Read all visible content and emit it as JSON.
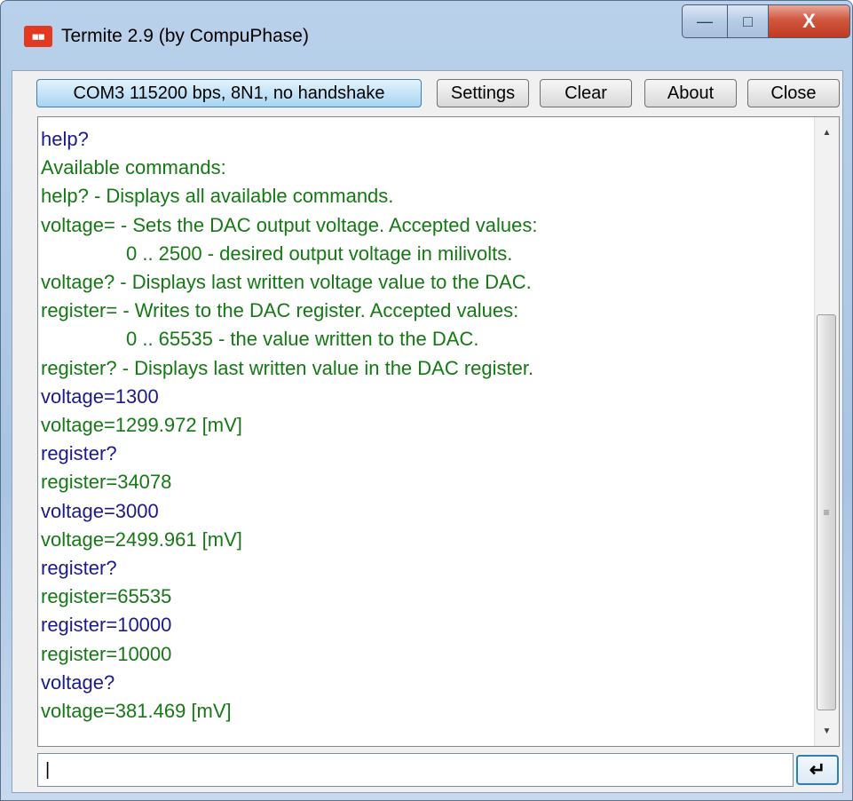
{
  "window": {
    "title": "Termite 2.9 (by CompuPhase)",
    "app_icon": "termite-icon",
    "controls": {
      "minimize": "—",
      "maximize": "□",
      "close": "X"
    }
  },
  "toolbar": {
    "port_label": "COM3 115200 bps, 8N1, no handshake",
    "settings_label": "Settings",
    "clear_label": "Clear",
    "about_label": "About",
    "close_label": "Close"
  },
  "terminal": {
    "lines": [
      {
        "text": "help?",
        "kind": "tx",
        "indent": false
      },
      {
        "text": "Available commands:",
        "kind": "rx",
        "indent": false
      },
      {
        "text": "help? - Displays all available commands.",
        "kind": "rx",
        "indent": false
      },
      {
        "text": "voltage= - Sets the DAC output voltage. Accepted values:",
        "kind": "rx",
        "indent": false
      },
      {
        "text": "0 .. 2500 - desired output voltage in milivolts.",
        "kind": "rx",
        "indent": true
      },
      {
        "text": "voltage? - Displays last written voltage value to the DAC.",
        "kind": "rx",
        "indent": false
      },
      {
        "text": "register= - Writes to the DAC register. Accepted values:",
        "kind": "rx",
        "indent": false
      },
      {
        "text": "0 .. 65535 - the value written to the DAC.",
        "kind": "rx",
        "indent": true
      },
      {
        "text": "register? - Displays last written value in the DAC register.",
        "kind": "rx",
        "indent": false
      },
      {
        "text": "voltage=1300",
        "kind": "tx",
        "indent": false
      },
      {
        "text": "voltage=1299.972 [mV]",
        "kind": "rx",
        "indent": false
      },
      {
        "text": "register?",
        "kind": "tx",
        "indent": false
      },
      {
        "text": "register=34078",
        "kind": "rx",
        "indent": false
      },
      {
        "text": "voltage=3000",
        "kind": "tx",
        "indent": false
      },
      {
        "text": "voltage=2499.961 [mV]",
        "kind": "rx",
        "indent": false
      },
      {
        "text": "register?",
        "kind": "tx",
        "indent": false
      },
      {
        "text": "register=65535",
        "kind": "rx",
        "indent": false
      },
      {
        "text": "register=10000",
        "kind": "tx",
        "indent": false
      },
      {
        "text": "register=10000",
        "kind": "rx",
        "indent": false
      },
      {
        "text": "voltage?",
        "kind": "tx",
        "indent": false
      },
      {
        "text": "voltage=381.469 [mV]",
        "kind": "rx",
        "indent": false
      }
    ],
    "colors": {
      "tx": "#1a1a8c",
      "rx": "#157815"
    }
  },
  "input": {
    "value": "|",
    "send_icon": "enter-icon",
    "send_glyph": "↵"
  },
  "scrollbar": {
    "up_glyph": "▲",
    "down_glyph": "▼",
    "grip_glyph": "≡"
  }
}
